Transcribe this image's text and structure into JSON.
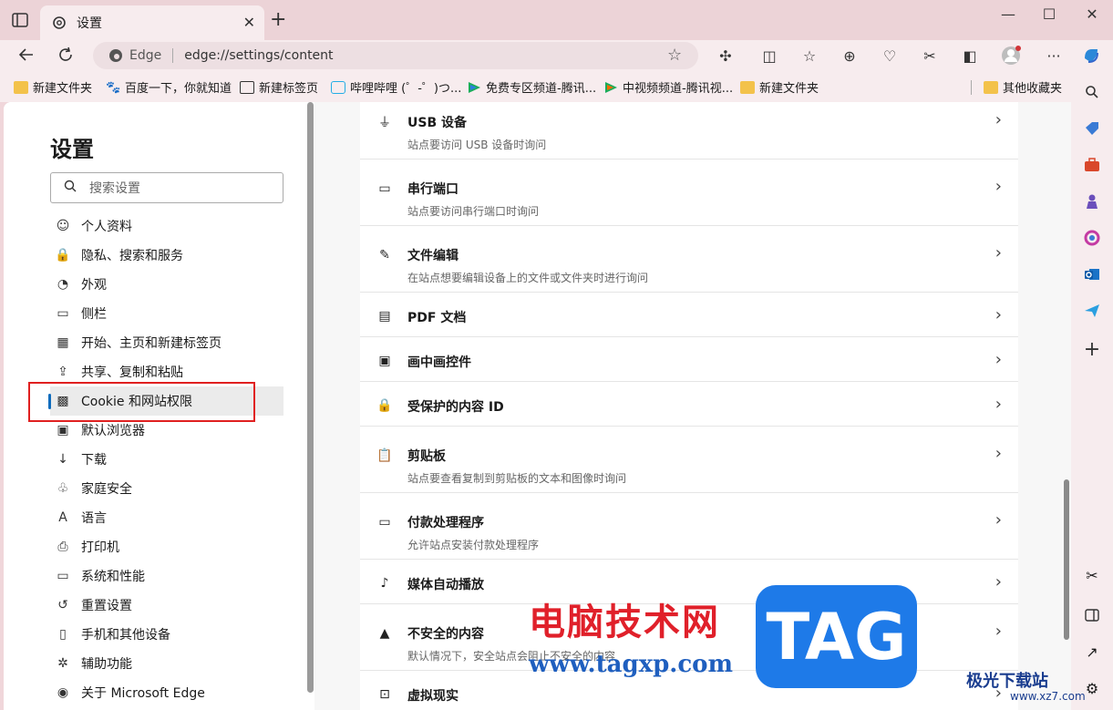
{
  "tab": {
    "title": "设置",
    "close": "✕",
    "new": "+"
  },
  "window": {
    "min": "—",
    "max": "☐",
    "close": "✕"
  },
  "address": {
    "site": "Edge",
    "url": "edge://settings/content"
  },
  "bookmarks": [
    {
      "label": "新建文件夹",
      "icon": "folder-icon"
    },
    {
      "label": "百度一下，你就知道",
      "icon": "baidu-icon"
    },
    {
      "label": "新建标签页",
      "icon": "newtab-icon"
    },
    {
      "label": "哔哩哔哩 (゜-゜)つ...",
      "icon": "bilibili-icon"
    },
    {
      "label": "免费专区频道-腾讯...",
      "icon": "tencent-video-icon"
    },
    {
      "label": "中视频频道-腾讯视...",
      "icon": "tencent-video-icon"
    },
    {
      "label": "新建文件夹",
      "icon": "folder-icon"
    }
  ],
  "other_bookmarks": "其他收藏夹",
  "settings": {
    "title": "设置",
    "search_placeholder": "搜索设置",
    "nav": [
      {
        "label": "个人资料",
        "icon": "profile-icon"
      },
      {
        "label": "隐私、搜索和服务",
        "icon": "lock-icon"
      },
      {
        "label": "外观",
        "icon": "palette-icon"
      },
      {
        "label": "侧栏",
        "icon": "sidebar-icon"
      },
      {
        "label": "开始、主页和新建标签页",
        "icon": "home-icon"
      },
      {
        "label": "共享、复制和粘贴",
        "icon": "share-icon"
      },
      {
        "label": "Cookie 和网站权限",
        "icon": "cookie-icon",
        "active": true
      },
      {
        "label": "默认浏览器",
        "icon": "browser-icon"
      },
      {
        "label": "下载",
        "icon": "download-icon"
      },
      {
        "label": "家庭安全",
        "icon": "family-icon"
      },
      {
        "label": "语言",
        "icon": "language-icon"
      },
      {
        "label": "打印机",
        "icon": "printer-icon"
      },
      {
        "label": "系统和性能",
        "icon": "system-icon"
      },
      {
        "label": "重置设置",
        "icon": "reset-icon"
      },
      {
        "label": "手机和其他设备",
        "icon": "phone-icon"
      },
      {
        "label": "辅助功能",
        "icon": "accessibility-icon"
      },
      {
        "label": "关于 Microsoft Edge",
        "icon": "edge-icon"
      }
    ]
  },
  "permissions": [
    {
      "title": "USB 设备",
      "desc": "站点要访问 USB 设备时询问",
      "icon": "usb-icon",
      "glyph": "⏚"
    },
    {
      "title": "串行端口",
      "desc": "站点要访问串行端口时询问",
      "icon": "serial-port-icon",
      "glyph": "▭"
    },
    {
      "title": "文件编辑",
      "desc": "在站点想要编辑设备上的文件或文件夹时进行询问",
      "icon": "file-edit-icon",
      "glyph": "✎"
    },
    {
      "title": "PDF 文档",
      "desc": "",
      "icon": "pdf-icon",
      "glyph": "▤"
    },
    {
      "title": "画中画控件",
      "desc": "",
      "icon": "pip-icon",
      "glyph": "▣"
    },
    {
      "title": "受保护的内容 ID",
      "desc": "",
      "icon": "lock-icon",
      "glyph": "🔒"
    },
    {
      "title": "剪贴板",
      "desc": "站点要查看复制到剪贴板的文本和图像时询问",
      "icon": "clipboard-icon",
      "glyph": "📋"
    },
    {
      "title": "付款处理程序",
      "desc": "允许站点安装付款处理程序",
      "icon": "payment-icon",
      "glyph": "▭"
    },
    {
      "title": "媒体自动播放",
      "desc": "",
      "icon": "music-icon",
      "glyph": "♪"
    },
    {
      "title": "不安全的内容",
      "desc": "默认情况下，安全站点会阻止不安全的内容",
      "icon": "warning-icon",
      "glyph": "▲"
    },
    {
      "title": "虚拟现实",
      "desc": "",
      "icon": "vr-icon",
      "glyph": "⊡"
    }
  ],
  "watermark": {
    "cn": "电脑技术网",
    "url": "www.tagxp.com",
    "tag": "TAG",
    "site": "极光下载站",
    "site_url": "www.xz7.com"
  }
}
